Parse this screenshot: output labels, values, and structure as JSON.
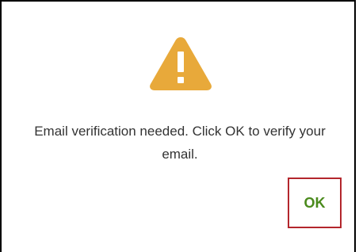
{
  "dialog": {
    "icon": "warning-icon",
    "icon_color": "#e8a93a",
    "message": "Email verification needed. Click OK to verify your email.",
    "ok_label": "OK",
    "ok_color": "#4a8a1c",
    "highlight_color": "#b3262c"
  }
}
